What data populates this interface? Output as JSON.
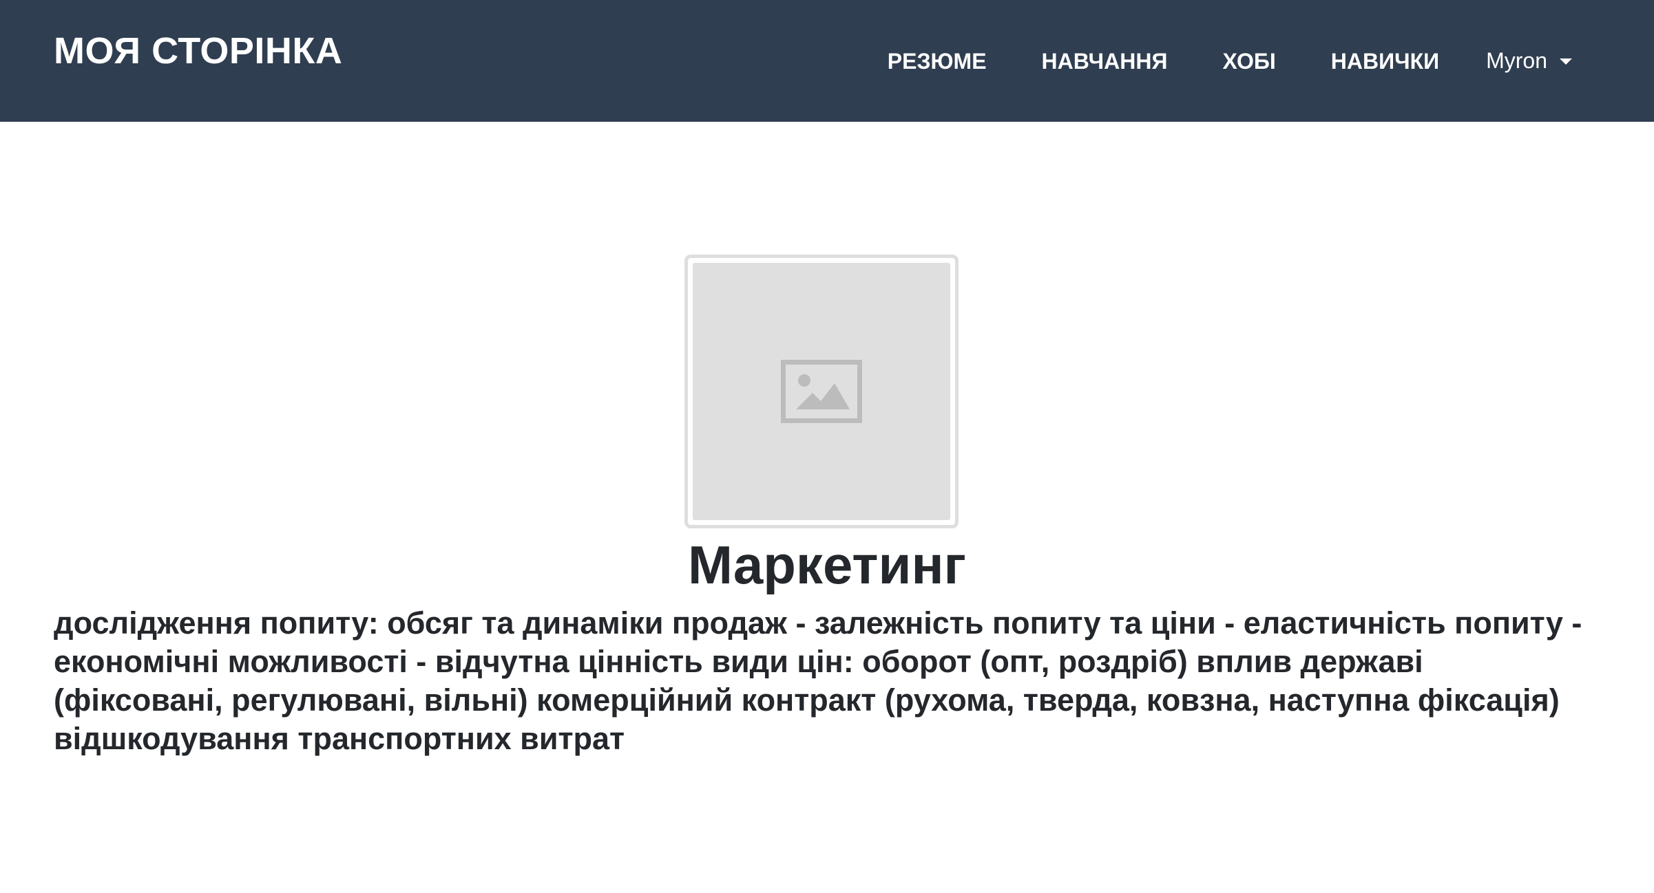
{
  "navbar": {
    "brand": "МОЯ СТОРІНКА",
    "links": [
      "РЕЗЮМЕ",
      "НАВЧАННЯ",
      "ХОБІ",
      "НАВИЧКИ"
    ],
    "user": "Myron",
    "background_color": "#2f3e50"
  },
  "main": {
    "image_icon": "image-placeholder-icon",
    "title": "Маркетинг",
    "description": "дослідження попиту: обсяг та динаміки продаж - залежність попиту та ціни - еластичність попиту - економічні можливості - відчутна цінність види цін: оборот (опт, роздріб) вплив державі (фіксовані, регулювані, вільні) комерційний контракт (рухома, тверда, ковзна, наступна фіксація) відшкодування транспортних витрат"
  }
}
